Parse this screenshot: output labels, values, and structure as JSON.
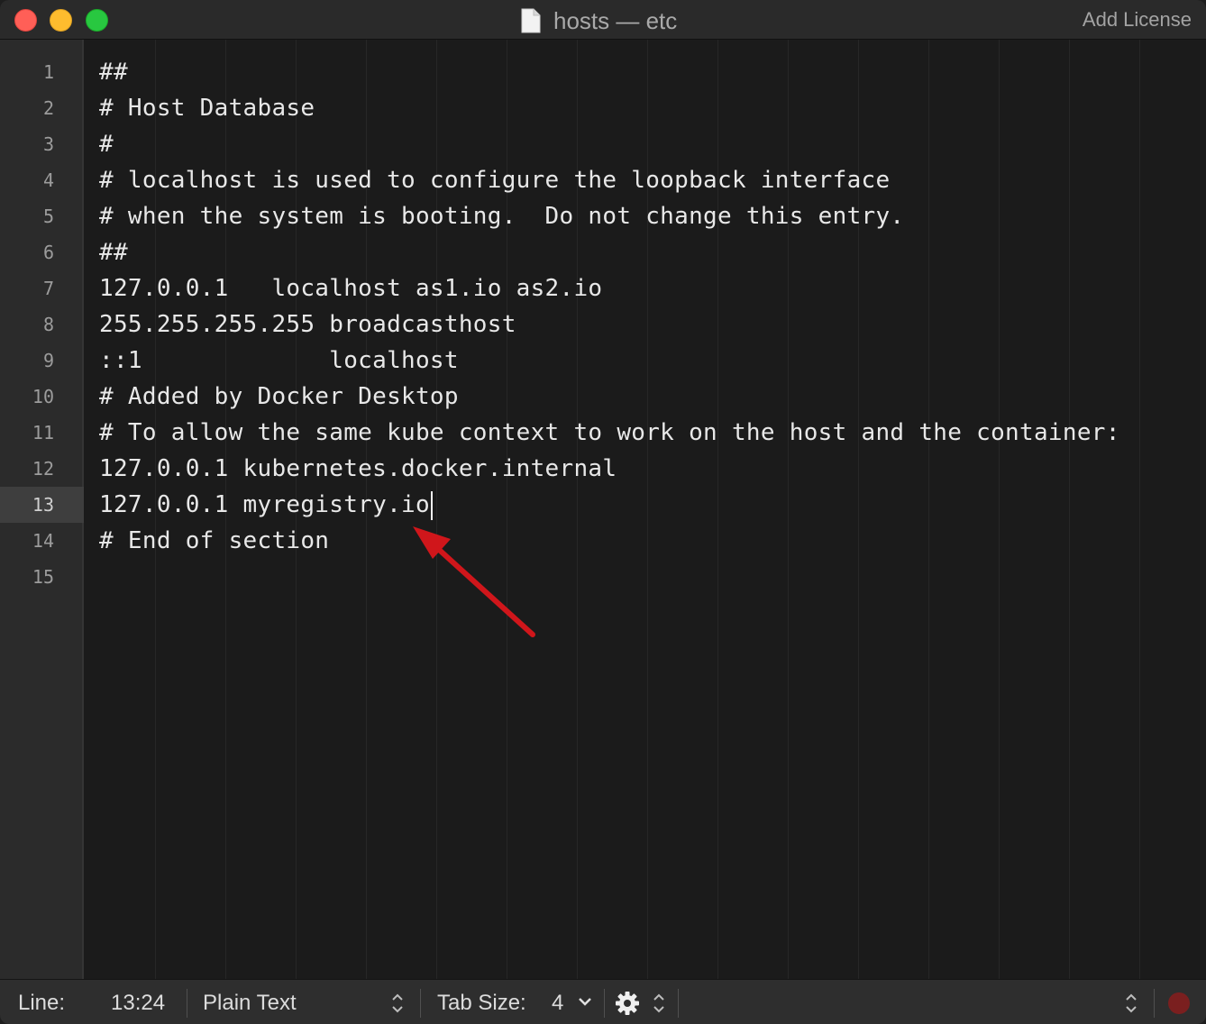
{
  "window": {
    "title": "hosts — etc",
    "add_license": "Add License"
  },
  "editor": {
    "current_line": 13,
    "lines": [
      {
        "n": "1",
        "text": "##"
      },
      {
        "n": "2",
        "text": "# Host Database"
      },
      {
        "n": "3",
        "text": "#"
      },
      {
        "n": "4",
        "text": "# localhost is used to configure the loopback interface"
      },
      {
        "n": "5",
        "text": "# when the system is booting.  Do not change this entry."
      },
      {
        "n": "6",
        "text": "##"
      },
      {
        "n": "7",
        "text": "127.0.0.1   localhost as1.io as2.io"
      },
      {
        "n": "8",
        "text": "255.255.255.255 broadcasthost"
      },
      {
        "n": "9",
        "text": "::1             localhost"
      },
      {
        "n": "10",
        "text": "# Added by Docker Desktop"
      },
      {
        "n": "11",
        "text": "# To allow the same kube context to work on the host and the container:"
      },
      {
        "n": "12",
        "text": "127.0.0.1 kubernetes.docker.internal"
      },
      {
        "n": "13",
        "text": "127.0.0.1 myregistry.io"
      },
      {
        "n": "14",
        "text": "# End of section"
      },
      {
        "n": "15",
        "text": ""
      }
    ]
  },
  "statusbar": {
    "line_label": "Line:",
    "line_value": "13:24",
    "syntax": "Plain Text",
    "tab_size_label": "Tab Size:",
    "tab_size_value": "4"
  },
  "colors": {
    "annotation_arrow": "#d0161b",
    "close": "#ff5f57",
    "minimize": "#febc2e",
    "maximize": "#28c840"
  },
  "icons": [
    "document-icon",
    "chevron-down-icon",
    "gear-icon",
    "up-down-chevron-icon",
    "record-icon"
  ]
}
